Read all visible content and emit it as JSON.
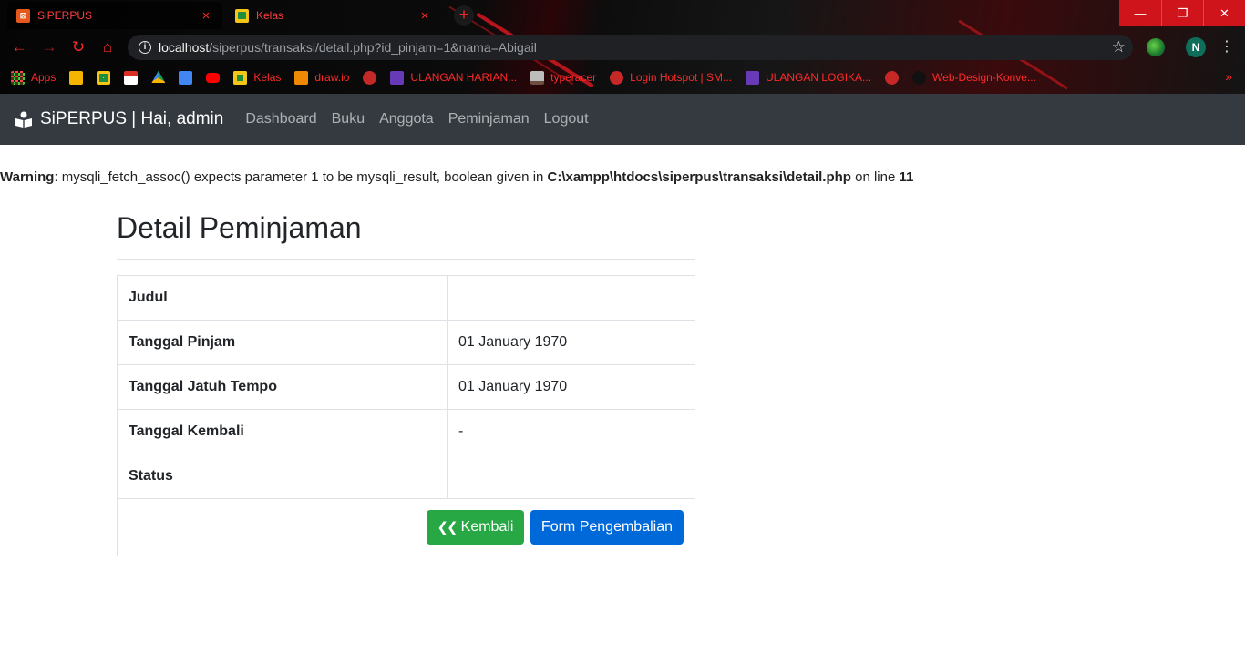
{
  "browser": {
    "tabs": [
      {
        "title": "SiPERPUS",
        "active": true,
        "favicon": "xampp-icon"
      },
      {
        "title": "Kelas",
        "active": false,
        "favicon": "classroom-icon"
      }
    ],
    "new_tab": "+",
    "url_host": "localhost",
    "url_path": "/siperpus/transaksi/detail.php?id_pinjam=1&nama=Abigail",
    "profile_initial": "N",
    "bookmarks": [
      {
        "label": "Apps",
        "icon": "apps-grid-icon"
      },
      {
        "label": "",
        "icon": "slides-icon"
      },
      {
        "label": "",
        "icon": "classroom-icon"
      },
      {
        "label": "",
        "icon": "gmail-icon"
      },
      {
        "label": "",
        "icon": "drive-icon"
      },
      {
        "label": "",
        "icon": "docs-icon"
      },
      {
        "label": "",
        "icon": "youtube-icon"
      },
      {
        "label": "Kelas",
        "icon": "classroom-icon"
      },
      {
        "label": "draw.io",
        "icon": "drawio-icon"
      },
      {
        "label": "",
        "icon": "globe-icon"
      },
      {
        "label": "ULANGAN HARIAN...",
        "icon": "forms-icon"
      },
      {
        "label": "typeracer",
        "icon": "typeracer-icon"
      },
      {
        "label": "Login Hotspot | SM...",
        "icon": "globe-icon"
      },
      {
        "label": "ULANGAN LOGIKA...",
        "icon": "forms-icon"
      },
      {
        "label": "",
        "icon": "globe-icon"
      },
      {
        "label": "Web-Design-Konve...",
        "icon": "github-icon"
      }
    ],
    "bookmarks_more": "»",
    "colors": {
      "accent": "#ff2a2a",
      "window_controls": "#d0141b"
    }
  },
  "navbar": {
    "brand": "SiPERPUS | Hai, admin",
    "links": [
      "Dashboard",
      "Buku",
      "Anggota",
      "Peminjaman",
      "Logout"
    ],
    "background": "#343a40"
  },
  "warning": {
    "label": "Warning",
    "message": ": mysqli_fetch_assoc() expects parameter 1 to be mysqli_result, boolean given in ",
    "file": "C:\\xampp\\htdocs\\siperpus\\transaksi\\detail.php",
    "on_line": " on line ",
    "line": "11"
  },
  "main": {
    "title": "Detail Peminjaman",
    "rows": [
      {
        "label": "Judul",
        "value": ""
      },
      {
        "label": "Tanggal Pinjam",
        "value": "01 January 1970"
      },
      {
        "label": "Tanggal Jatuh Tempo",
        "value": "01 January 1970"
      },
      {
        "label": "Tanggal Kembali",
        "value": "-"
      },
      {
        "label": "Status",
        "value": ""
      }
    ],
    "back_button": "Kembali",
    "return_form_button": "Form Pengembalian",
    "colors": {
      "success": "#28a745",
      "primary": "#0069d9"
    }
  }
}
